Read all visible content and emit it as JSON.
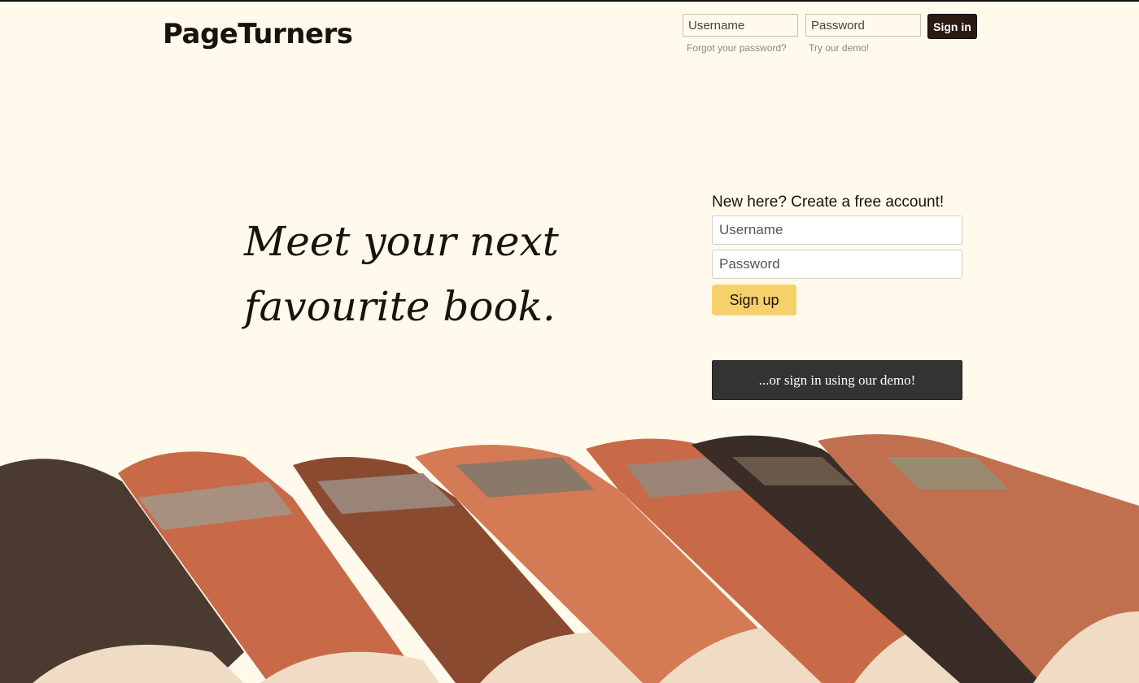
{
  "header": {
    "logo": "PageTurners",
    "username_placeholder": "Username",
    "password_placeholder": "Password",
    "sign_in_label": "Sign in",
    "forgot_password": "Forgot your password?",
    "try_demo": "Try our demo!"
  },
  "hero": {
    "tagline_line1": "Meet your next",
    "tagline_line2": "favourite book."
  },
  "signup": {
    "title": "New here? Create a free account!",
    "username_placeholder": "Username",
    "password_placeholder": "Password",
    "sign_up_label": "Sign up",
    "demo_label": "...or sign in using our demo!"
  },
  "colors": {
    "background": "#fffaeb",
    "accent": "#f6d06a",
    "dark": "#2a1a12"
  }
}
